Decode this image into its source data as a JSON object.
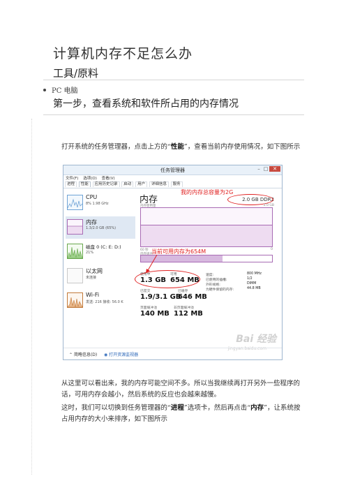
{
  "doc": {
    "title": "计算机内存不足怎么办",
    "tools_heading": "工具/原料",
    "tool_item": "PC 电脑",
    "step1_heading": "第一步，查看系统和软件所占用的内存情况",
    "para1_a": "打开系统的任务管理器，点击上方的“",
    "para1_bold": "性能",
    "para1_b": "”，查看当前内存使用情况，如下图所示",
    "para2": "从这里可以看出来，我的内存可能空间不多。所以当我继续再打开另外一些程序的话，可用内存会越小，然后系统的反应也会越来越慢。",
    "para3_a": "这时，我们可以切换到任务管理器的“",
    "para3_bold1": "进程",
    "para3_b": "”选项卡，然后再点击“",
    "para3_bold2": "内存",
    "para3_c": "”，让系统按占用内存的大小来排序，如下图所示"
  },
  "taskmgr": {
    "title": "任务管理器",
    "menu": [
      "文件(F)",
      "选项(O)",
      "查看(V)"
    ],
    "tabs": [
      "进程",
      "性能",
      "应用历史记录",
      "启动",
      "用户",
      "详细信息",
      "服务"
    ],
    "active_tab": "性能",
    "side": [
      {
        "name": "CPU",
        "sub": "8% 1.98 GHz",
        "color": "#6fa3d6"
      },
      {
        "name": "内存",
        "sub": "1.3/2.0 GB (65%)",
        "color": "#a86bb4"
      },
      {
        "name": "磁盘 0 (C: E: D:)",
        "sub": "21%",
        "color": "#6aa84f"
      },
      {
        "name": "以太网",
        "sub": "未连接",
        "color": "#c27a3a"
      },
      {
        "name": "Wi-Fi",
        "sub": "发送: 216 接收: 56.0 K",
        "color": "#c27a3a"
      }
    ],
    "memory_title": "内存",
    "ddr": "2.0 GB DDR2",
    "usage_label": "内存使用量",
    "usage_max": "2.0 GB",
    "time_label": "60 秒",
    "zero": "0",
    "composition_label": "内存组合",
    "usage_fraction": 0.65,
    "stats": {
      "in_use_label": "使用中",
      "in_use": "1.3 GB",
      "available_label": "可用",
      "available": "654 MB",
      "committed_label": "已提交",
      "committed": "1.9/3.1 GB",
      "cached_label": "已缓存",
      "cached": "646 MB",
      "paged_label": "页面缓冲池",
      "paged": "140 MB",
      "nonpaged_label": "非页面缓冲池",
      "nonpaged": "112 MB"
    },
    "details": [
      {
        "k": "速度:",
        "v": "800 MHz"
      },
      {
        "k": "已使用的插槽:",
        "v": "1/2"
      },
      {
        "k": "外形规格:",
        "v": "DIMM"
      },
      {
        "k": "为硬件保留的内存:",
        "v": "44.8 MB"
      }
    ],
    "annot_total": "我的内存总容量为2G",
    "annot_avail": "当前可用内存为654M",
    "footer_brief": "简略信息(D)",
    "footer_link": "打开资源监视器",
    "watermark": "Bai 经验",
    "watermark_url": "jingyan.baidu.com"
  }
}
